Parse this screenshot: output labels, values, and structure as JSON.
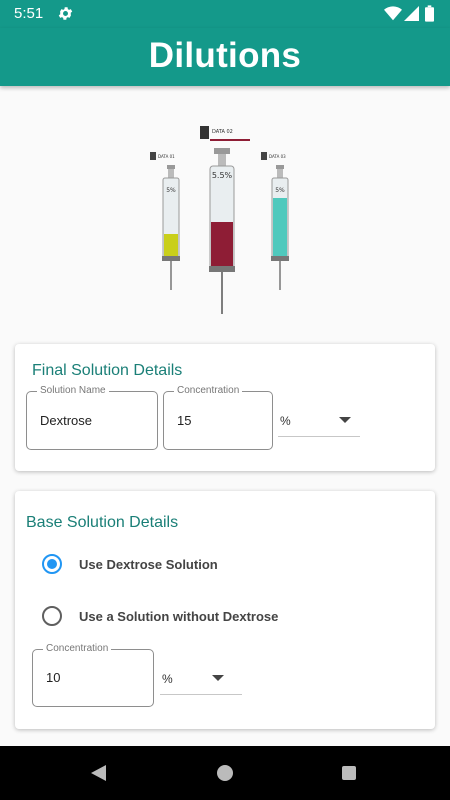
{
  "status_bar": {
    "time": "5:51"
  },
  "app_bar": {
    "title": "Dilutions"
  },
  "illustration": {
    "syringes": [
      {
        "label": "5%",
        "fill_level": 0.3,
        "color": "#c9cf1a"
      },
      {
        "label": "5.5%",
        "fill_level": 0.45,
        "color": "#8e1d35"
      },
      {
        "label": "5%",
        "fill_level": 0.75,
        "color": "#4fc9bd"
      }
    ],
    "tags": [
      "DATA 01",
      "DATA 02",
      "DATA 03"
    ]
  },
  "final_solution": {
    "title": "Final Solution Details",
    "name_field": {
      "label": "Solution Name",
      "value": "Dextrose"
    },
    "concentration_field": {
      "label": "Concentration",
      "value": "15"
    },
    "unit": "%"
  },
  "base_solution": {
    "title": "Base Solution Details",
    "options": [
      {
        "label": "Use Dextrose Solution",
        "selected": true
      },
      {
        "label": "Use a Solution without Dextrose",
        "selected": false
      }
    ],
    "concentration_field": {
      "label": "Concentration",
      "value": "10"
    },
    "unit": "%"
  },
  "colors": {
    "primary": "#14998a",
    "title_text": "#1a7f77",
    "radio_accent": "#2196f3"
  }
}
